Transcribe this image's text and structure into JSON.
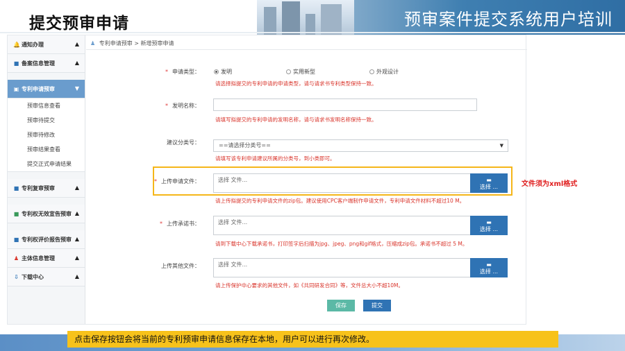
{
  "slide": {
    "title": "提交预审申请",
    "system_name": "预审案件提交系统用户培训",
    "bottom_note": "点击保存按钮会将当前的专利预审申请信息保存在本地，用户可以进行再次修改。",
    "callout": "文件须为xml格式"
  },
  "sidebar": {
    "items": [
      {
        "label": "通知办理",
        "icon": "bell-icon",
        "glyph": "🔔",
        "arrow": "▲"
      },
      {
        "label": "备案信息管理",
        "icon": "folder-icon",
        "glyph": "■",
        "arrow": "▲"
      },
      {
        "label": "专利申请预审",
        "icon": "document-icon",
        "glyph": "▣",
        "arrow": "▼"
      },
      {
        "label": "专利复审预审",
        "icon": "folder-icon",
        "glyph": "■",
        "arrow": "▲"
      },
      {
        "label": "专利权无效宣告预审",
        "icon": "folder-icon",
        "glyph": "■",
        "arrow": "▲"
      },
      {
        "label": "专利权评价报告预审",
        "icon": "folder-icon",
        "glyph": "■",
        "arrow": "▲"
      },
      {
        "label": "主体信息管理",
        "icon": "person-icon",
        "glyph": "♟",
        "arrow": "▲"
      },
      {
        "label": "下载中心",
        "icon": "download-icon",
        "glyph": "⇩",
        "arrow": "▲"
      }
    ],
    "subitems": [
      "预审信息查看",
      "预审待提交",
      "预审待修改",
      "预审结果查看",
      "提交正式申请结果"
    ]
  },
  "breadcrumb": {
    "root": "专利申请预审",
    "separator": ">",
    "current": "新增预审申请"
  },
  "form": {
    "application_type": {
      "label": "申请类型：",
      "options": [
        "发明",
        "实用新型",
        "外观设计"
      ],
      "selected": "发明",
      "hint": "请选择拟提交的专利申请的申请类型，请与请求书专利类型保持一致。"
    },
    "invention_name": {
      "label": "发明名称：",
      "value": "",
      "hint": "请填写拟提交的专利申请的发明名称，请与请求书发明名称保持一致。"
    },
    "classification": {
      "label": "建议分类号：",
      "selected": "==请选择分类号==",
      "hint": "请填写该专利申请建议所属的分类号，到小类即可。"
    },
    "application_file": {
      "label": "上传申请文件：",
      "placeholder": "选择 文件...",
      "button": "选择 ...",
      "hint": "请上传拟提交的专利申请文件的zip包。建议使用CPC客户端制作申请文件，专利申请文件材料不超过10 M。"
    },
    "commitment": {
      "label": "上传承诺书：",
      "placeholder": "选择 文件...",
      "button": "选择 ...",
      "hint": "请到下载中心下载承诺书，打印签字后扫描为jpg、jpeg、png和gif格式，压缩成zip包。承诺书不超过 5 M。"
    },
    "other_files": {
      "label": "上传其他文件：",
      "placeholder": "选择 文件...",
      "button": "选择 ...",
      "hint": "请上传保护中心要求的其他文件，如《共同研发合同》等，文件总大小不超10M。"
    },
    "save_label": "保存",
    "submit_label": "提交"
  },
  "colors": {
    "accent_blue": "#2f73b4",
    "active_menu": "#6a9ccd",
    "save_green": "#5bb9a6",
    "hint_red": "#d9342b",
    "highlight_yellow": "#f5b619"
  }
}
